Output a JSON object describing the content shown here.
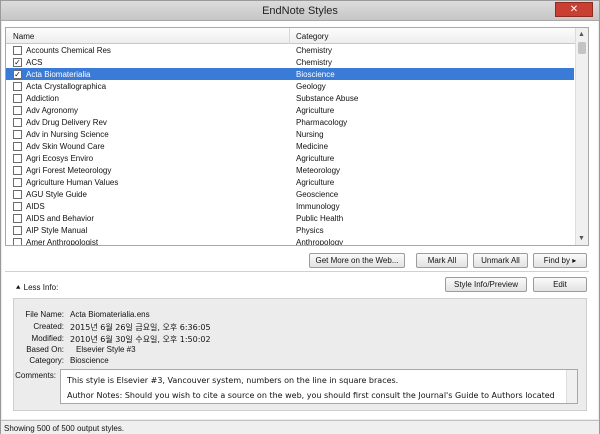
{
  "window": {
    "title": "EndNote Styles",
    "close_glyph": "✕"
  },
  "table": {
    "col_name": "Name",
    "col_category": "Category",
    "rows": [
      {
        "name": "Accounts Chemical Res",
        "category": "Chemistry",
        "checked": false,
        "selected": false
      },
      {
        "name": "ACS",
        "category": "Chemistry",
        "checked": true,
        "selected": false
      },
      {
        "name": "Acta Biomaterialia",
        "category": "Bioscience",
        "checked": true,
        "selected": true
      },
      {
        "name": "Acta Crystallographica",
        "category": "Geology",
        "checked": false,
        "selected": false
      },
      {
        "name": "Addiction",
        "category": "Substance Abuse",
        "checked": false,
        "selected": false
      },
      {
        "name": "Adv Agronomy",
        "category": "Agriculture",
        "checked": false,
        "selected": false
      },
      {
        "name": "Adv Drug Delivery Rev",
        "category": "Pharmacology",
        "checked": false,
        "selected": false
      },
      {
        "name": "Adv in Nursing Science",
        "category": "Nursing",
        "checked": false,
        "selected": false
      },
      {
        "name": "Adv Skin Wound Care",
        "category": "Medicine",
        "checked": false,
        "selected": false
      },
      {
        "name": "Agri Ecosys Enviro",
        "category": "Agriculture",
        "checked": false,
        "selected": false
      },
      {
        "name": "Agri Forest Meteorology",
        "category": "Meteorology",
        "checked": false,
        "selected": false
      },
      {
        "name": "Agriculture Human Values",
        "category": "Agriculture",
        "checked": false,
        "selected": false
      },
      {
        "name": "AGU Style Guide",
        "category": "Geoscience",
        "checked": false,
        "selected": false
      },
      {
        "name": "AIDS",
        "category": "Immunology",
        "checked": false,
        "selected": false
      },
      {
        "name": "AIDS and Behavior",
        "category": "Public Health",
        "checked": false,
        "selected": false
      },
      {
        "name": "AIP Style Manual",
        "category": "Physics",
        "checked": false,
        "selected": false
      },
      {
        "name": "Amer Anthropologist",
        "category": "Anthropology",
        "checked": false,
        "selected": false
      }
    ]
  },
  "buttons": {
    "get_more": "Get More on the Web...",
    "mark_all": "Mark All",
    "unmark_all": "Unmark All",
    "find_by": "Find by",
    "style_info": "Style Info/Preview",
    "edit": "Edit"
  },
  "less_info": "Less Info:",
  "info": {
    "file_name_label": "File Name:",
    "file_name": "Acta Biomaterialia.ens",
    "created_label": "Created:",
    "created": "2015년 6월 26일 금요일, 오후 6:36:05",
    "modified_label": "Modified:",
    "modified": "2010년 6월 30일 수요일, 오후 1:50:02",
    "based_on_label": "Based On:",
    "based_on": "Elsevier Style #3",
    "category_label": "Category:",
    "category": "Bioscience",
    "comments_label": "Comments:",
    "comments_line1": "This style is Elsevier #3, Vancouver system, numbers on the line in square braces.",
    "comments_line2": "Author Notes: Should you wish to cite a source on the web, you should first consult the Journal's Guide to Authors located here:"
  },
  "status": "Showing 500 of 500 output styles.",
  "colors": {
    "selection": "#3a7bd8",
    "window_bg": "#ececec"
  }
}
